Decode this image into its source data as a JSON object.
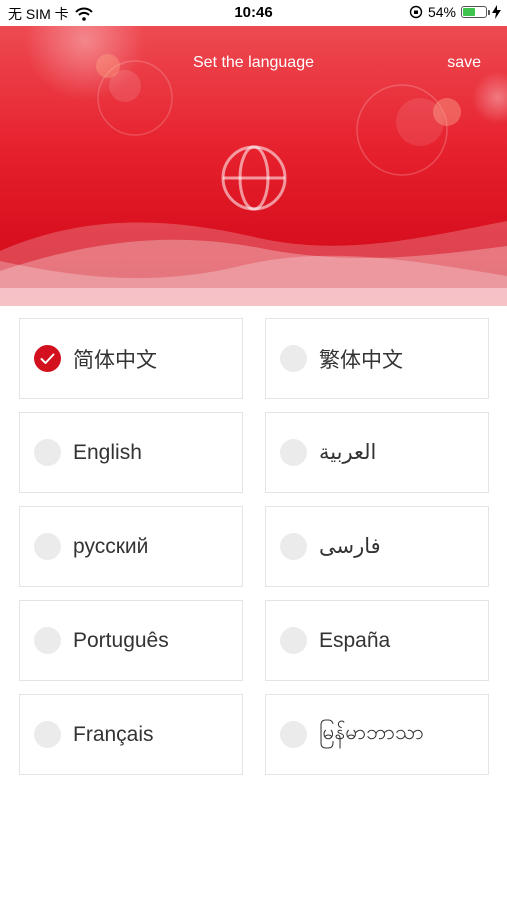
{
  "status_bar": {
    "carrier": "无 SIM 卡",
    "time": "10:46",
    "battery_percent": "54%",
    "battery_level": 0.54
  },
  "header": {
    "title": "Set the language",
    "save_label": "save",
    "accent_color": "#e6202d"
  },
  "languages": [
    {
      "label": "简体中文",
      "selected": true
    },
    {
      "label": "繁体中文",
      "selected": false
    },
    {
      "label": "English",
      "selected": false
    },
    {
      "label": "العربية",
      "selected": false
    },
    {
      "label": "русский",
      "selected": false
    },
    {
      "label": "فارسی",
      "selected": false
    },
    {
      "label": "Português",
      "selected": false
    },
    {
      "label": "España",
      "selected": false
    },
    {
      "label": "Français",
      "selected": false
    },
    {
      "label": "မြန်မာဘာသာ",
      "selected": false
    }
  ]
}
